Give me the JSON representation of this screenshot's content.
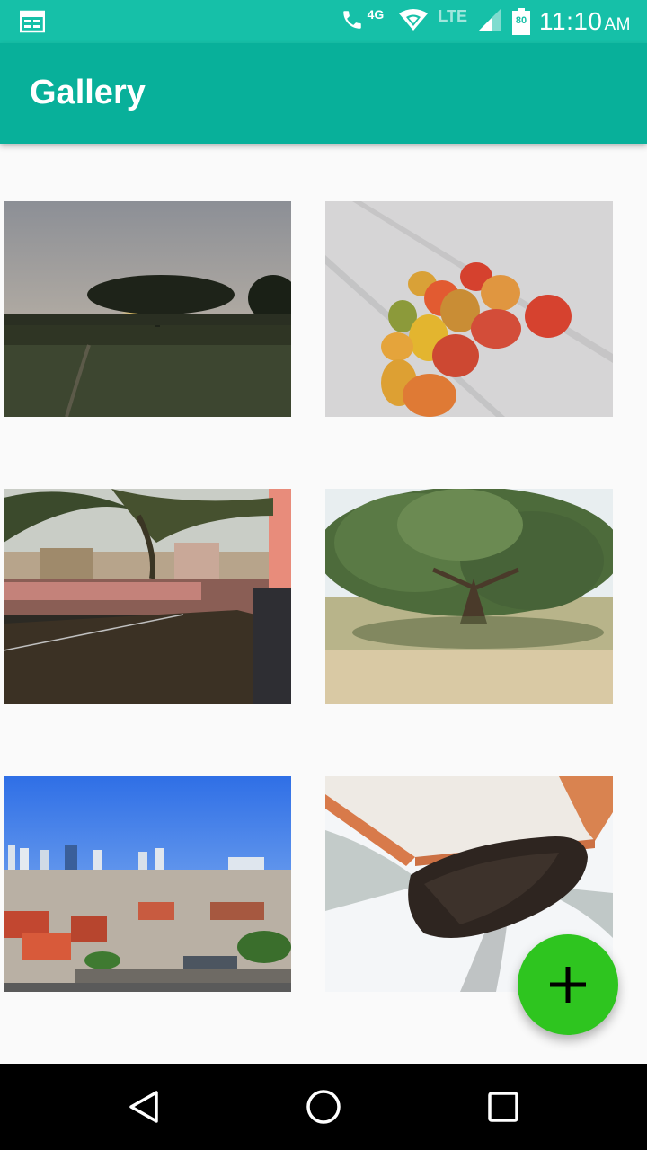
{
  "status_bar": {
    "time": "11:10",
    "ampm": "AM",
    "network": "4G",
    "lte": "LTE",
    "battery": "80"
  },
  "app_bar": {
    "title": "Gallery"
  },
  "gallery": {
    "images": [
      {
        "name": "sunset-field-photo"
      },
      {
        "name": "mangoes-on-floor-photo"
      },
      {
        "name": "palm-rooftop-photo"
      },
      {
        "name": "mango-tree-photo"
      },
      {
        "name": "city-skyline-photo"
      },
      {
        "name": "beehive-photo"
      }
    ]
  },
  "fab": {
    "icon": "plus-icon",
    "color": "#2ec51f"
  },
  "nav": {
    "back": "back-icon",
    "home": "home-icon",
    "recents": "recents-icon"
  },
  "colors": {
    "status_bar": "#16c0a8",
    "app_bar": "#08b09a",
    "background": "#fafafa"
  }
}
